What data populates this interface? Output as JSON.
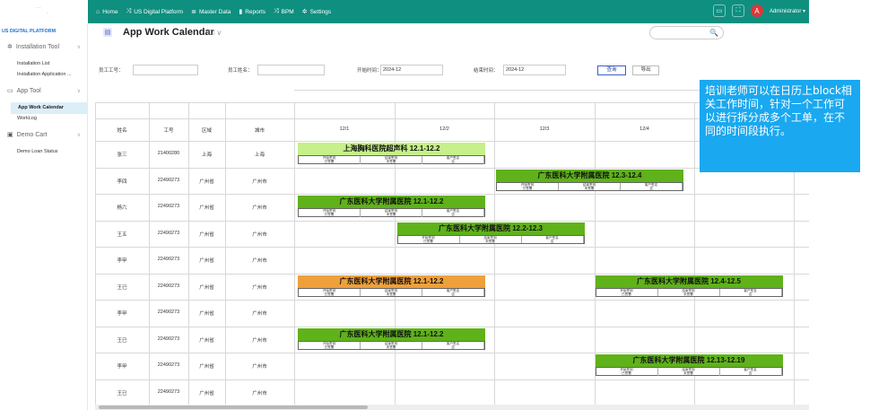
{
  "app": {
    "brand": "US DIGITAL PLATFORM"
  },
  "topnav": {
    "items": [
      {
        "icon": "home-icon",
        "glyph": "⌂",
        "label": "Home"
      },
      {
        "icon": "shuffle-icon",
        "glyph": "⤨",
        "label": "US Digital Platform"
      },
      {
        "icon": "database-icon",
        "glyph": "≣",
        "label": "Master Data"
      },
      {
        "icon": "chart-icon",
        "glyph": "▮",
        "label": "Reports"
      },
      {
        "icon": "shuffle-icon",
        "glyph": "⤨",
        "label": "BPM"
      },
      {
        "icon": "gear-icon",
        "glyph": "✲",
        "label": "Settings"
      }
    ],
    "user": {
      "initial": "A",
      "name": "Administrator ▾"
    }
  },
  "sidebar": {
    "groups": [
      {
        "label": "Installation Tool",
        "icon": "gear-icon",
        "glyph": "✲",
        "items": [
          "Installation List",
          "Installation Application ..."
        ]
      },
      {
        "label": "App Tool",
        "icon": "monitor-icon",
        "glyph": "▭",
        "items": [
          "App Work Calendar",
          "WorkLog"
        ]
      },
      {
        "label": "Demo Cart",
        "icon": "cart-icon",
        "glyph": "▣",
        "items": [
          "Demo Loan Status"
        ]
      }
    ],
    "active": "App Work Calendar"
  },
  "page": {
    "title": "App Work Calendar",
    "title_suffix": "☐ ∨",
    "search_icon": "search-icon",
    "search_glyph": "🔍"
  },
  "filters": {
    "employee_no": "员工工号：",
    "employee_name": "员工姓名：",
    "start_label": "开始时间：",
    "start_value": "2024-12",
    "end_label": "结束时间：",
    "end_value": "2024-12",
    "query": "查询",
    "export": "导出"
  },
  "table": {
    "headers": [
      "姓名",
      "工号",
      "区域",
      "城市"
    ],
    "dates": [
      "12/1",
      "12/2",
      "12/3",
      "12/4"
    ],
    "rows": [
      [
        "张三",
        "21400280",
        "上海",
        "上海"
      ],
      [
        "李四",
        "22490273",
        "广州省",
        "广州市"
      ],
      [
        "杨六",
        "22490273",
        "广州省",
        "广州市"
      ],
      [
        "王五",
        "22490273",
        "广州省",
        "广州市"
      ],
      [
        "李甲",
        "22490273",
        "广州省",
        "广州市"
      ],
      [
        "王已",
        "22490273",
        "广州省",
        "广州市"
      ],
      [
        "李甲",
        "22490273",
        "广州省",
        "广州市"
      ],
      [
        "王已",
        "22490273",
        "广州省",
        "广州市"
      ],
      [
        "李甲",
        "22490273",
        "广州省",
        "广州市"
      ],
      [
        "王已",
        "22490273",
        "广州省",
        "广州市"
      ]
    ]
  },
  "blocks": [
    {
      "title": "上海胸科医院超声科 12.1-12.2",
      "color": "#c6f08a",
      "row": 0,
      "start": 0,
      "span": 2
    },
    {
      "title": "广东医科大学附属医院 12.3-12.4",
      "color": "#5fb21a",
      "row": 1,
      "start": 2,
      "span": 2
    },
    {
      "title": "广东医科大学附属医院 12.1-12.2",
      "color": "#5fb21a",
      "row": 2,
      "start": 0,
      "span": 2
    },
    {
      "title": "广东医科大学附属医院 12.2-12.3",
      "color": "#5fb21a",
      "row": 3,
      "start": 1,
      "span": 2
    },
    {
      "title": "广东医科大学附属医院 12.1-12.2",
      "color": "#f0a03a",
      "row": 5,
      "start": 0,
      "span": 2
    },
    {
      "title": "广东医科大学附属医院 12.4-12.5",
      "color": "#5fb21a",
      "row": 5,
      "start": 3,
      "span": 2
    },
    {
      "title": "广东医科大学附属医院 12.1-12.2",
      "color": "#5fb21a",
      "row": 7,
      "start": 0,
      "span": 2
    },
    {
      "title": "广东医科大学附属医院 12.13-12.19",
      "color": "#5fb21a",
      "row": 8,
      "start": 3,
      "span": 2
    }
  ],
  "block_sub": {
    "r1": [
      "开始签到",
      "结束签到",
      "客户签名"
    ],
    "r2": [
      "已签署",
      "未签署",
      "否"
    ]
  },
  "note": {
    "text": "培训老师可以在日历上block相关工作时间，针对一个工作可以进行拆分成多个工单，在不同的时间段执行。"
  }
}
